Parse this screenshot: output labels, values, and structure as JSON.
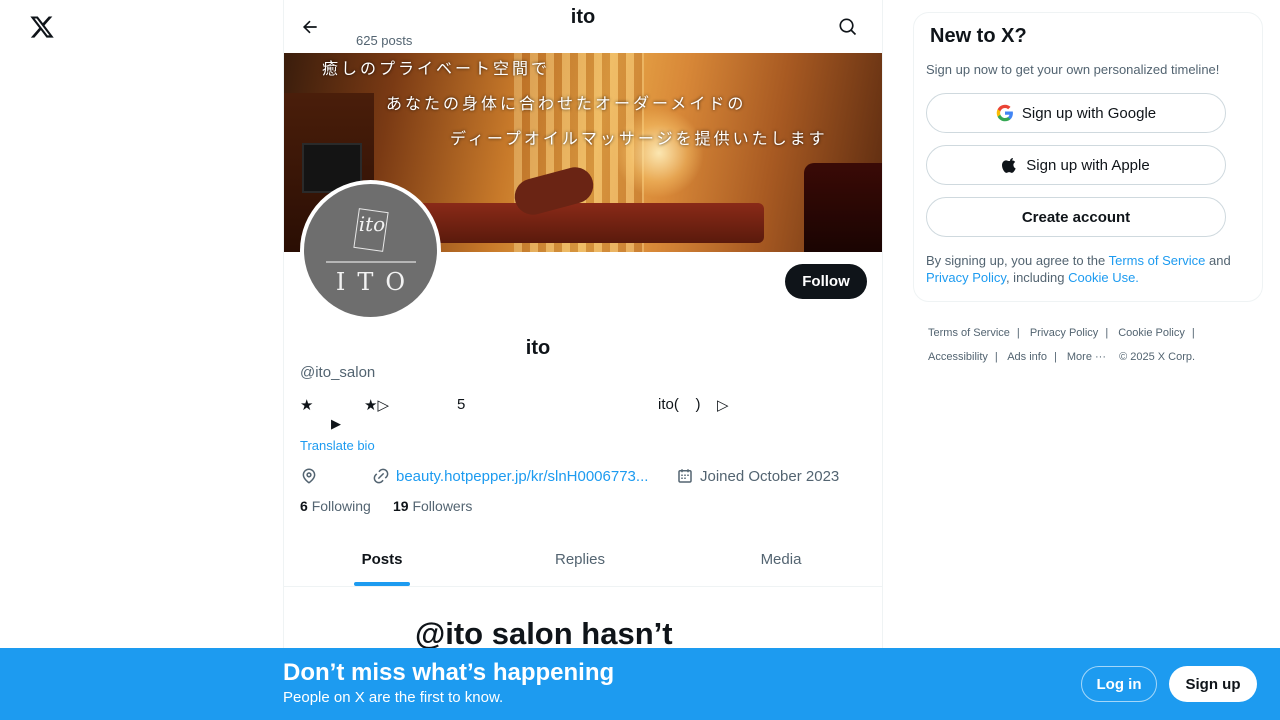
{
  "app": {
    "logo_icon": "x-logo-icon"
  },
  "header": {
    "title": "ito",
    "post_count": "625 posts",
    "back_icon": "arrow-left-icon",
    "search_icon": "search-icon"
  },
  "banner": {
    "line1": "癒しのプライベート空間で",
    "line2": "あなたの身体に合わせたオーダーメイドの",
    "line3": "ディープオイルマッサージを提供いたします"
  },
  "avatar": {
    "scribble": "ito",
    "text": "ITO"
  },
  "profile": {
    "follow_label": "Follow",
    "display_name": "ito",
    "handle": "@ito_salon",
    "bio_segments": [
      "★",
      "★▷",
      "5",
      "ito(    )",
      "▷"
    ],
    "bio_line2": "▶",
    "translate_label": "Translate bio",
    "location_icon": "location-icon",
    "link_icon": "link-icon",
    "link": "beauty.hotpepper.jp/kr/slnH0006773...",
    "calendar_icon": "calendar-icon",
    "joined": "Joined October 2023",
    "following_count": "6",
    "following_label": "Following",
    "followers_count": "19",
    "followers_label": "Followers"
  },
  "tabs": [
    {
      "label": "Posts",
      "active": true
    },
    {
      "label": "Replies",
      "active": false
    },
    {
      "label": "Media",
      "active": false
    }
  ],
  "empty_state": {
    "title": "@ito salon hasn’t"
  },
  "signup_card": {
    "title": "New to X?",
    "subtitle": "Sign up now to get your own personalized timeline!",
    "google_label": "Sign up with Google",
    "apple_label": "Sign up with Apple",
    "create_label": "Create account",
    "terms_prefix": "By signing up, you agree to the ",
    "terms_link": "Terms of Service",
    "terms_and": " and ",
    "privacy_link": "Privacy Policy",
    "including": ", including ",
    "cookie_link": "Cookie Use."
  },
  "footer": {
    "terms": "Terms of Service",
    "privacy": "Privacy Policy",
    "cookie": "Cookie Policy",
    "accessibility": "Accessibility",
    "ads": "Ads info",
    "more": "More ···",
    "copyright": "© 2025 X Corp."
  },
  "bottom_bar": {
    "title": "Don’t miss what’s happening",
    "subtitle": "People on X are the first to know.",
    "login_label": "Log in",
    "signup_label": "Sign up"
  },
  "colors": {
    "accent": "#1d9bf0",
    "text": "#0f1419",
    "muted": "#536471"
  }
}
